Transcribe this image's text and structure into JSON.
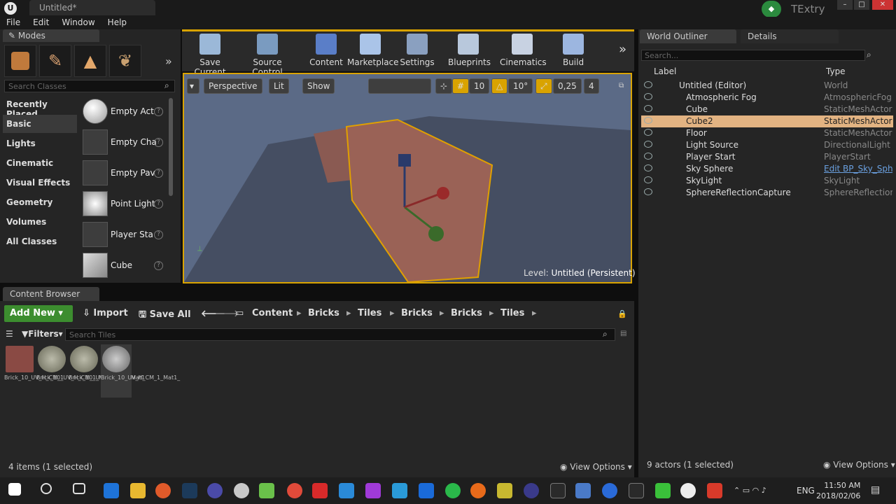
{
  "window": {
    "tab_title": "Untitled*",
    "project_name": "TExtry"
  },
  "menu": [
    "File",
    "Edit",
    "Window",
    "Help"
  ],
  "modes": {
    "tab_label": "Modes",
    "search_placeholder": "Search Classes",
    "categories": [
      "Recently Placed",
      "Basic",
      "Lights",
      "Cinematic",
      "Visual Effects",
      "Geometry",
      "Volumes",
      "All Classes"
    ],
    "selected_category": "Basic",
    "items": [
      "Empty Act",
      "Empty Cha",
      "Empty Pav",
      "Point Light",
      "Player Sta",
      "Cube"
    ]
  },
  "toolbar": {
    "buttons": [
      "Save Current",
      "Source Control",
      "Content",
      "Marketplace",
      "Settings",
      "Blueprints",
      "Cinematics",
      "Build"
    ]
  },
  "viewport": {
    "view_mode": "Perspective",
    "lighting": "Lit",
    "show_label": "Show",
    "grid_snap": "10",
    "rotation_snap": "10°",
    "scale_snap": "0,25",
    "camera_speed": "4",
    "level_prefix": "Level:",
    "level_name": "Untitled (Persistent)"
  },
  "content_browser": {
    "tab_label": "Content Browser",
    "add_new": "Add New",
    "import": "Import",
    "save_all": "Save All",
    "breadcrumbs": [
      "Content",
      "Bricks",
      "Tiles",
      "Bricks",
      "Bricks",
      "Tiles"
    ],
    "filters_label": "Filters",
    "search_placeholder": "Search Tiles",
    "assets": [
      {
        "name": "Brick_10_UV_H_CM_1"
      },
      {
        "name": "Brick_10_UV_H_CM_1_Mat"
      },
      {
        "name": "Brick_10_UV_H_CM_1_Mat1"
      },
      {
        "name": "Brick_10_UV_H_CM_1_Mat1_"
      }
    ],
    "status": "4 items (1 selected)",
    "view_options": "View Options"
  },
  "outliner": {
    "tab_label": "World Outliner",
    "details_tab": "Details",
    "search_placeholder": "Search...",
    "col_label": "Label",
    "col_type": "Type",
    "rows": [
      {
        "label": "Untitled (Editor)",
        "type": "World"
      },
      {
        "label": "Atmospheric Fog",
        "type": "AtmosphericFog"
      },
      {
        "label": "Cube",
        "type": "StaticMeshActor"
      },
      {
        "label": "Cube2",
        "type": "StaticMeshActor"
      },
      {
        "label": "Floor",
        "type": "StaticMeshActor"
      },
      {
        "label": "Light Source",
        "type": "DirectionalLight"
      },
      {
        "label": "Player Start",
        "type": "PlayerStart"
      },
      {
        "label": "Sky Sphere",
        "type": "Edit BP_Sky_Sphere"
      },
      {
        "label": "SkyLight",
        "type": "SkyLight"
      },
      {
        "label": "SphereReflectionCapture",
        "type": "SphereReflectionCapture"
      }
    ],
    "selected_row": "Cube2",
    "status": "9 actors (1 selected)",
    "view_options": "View Options"
  },
  "taskbar": {
    "time": "11:50 AM",
    "date": "2018/02/06",
    "language": "ENG"
  }
}
